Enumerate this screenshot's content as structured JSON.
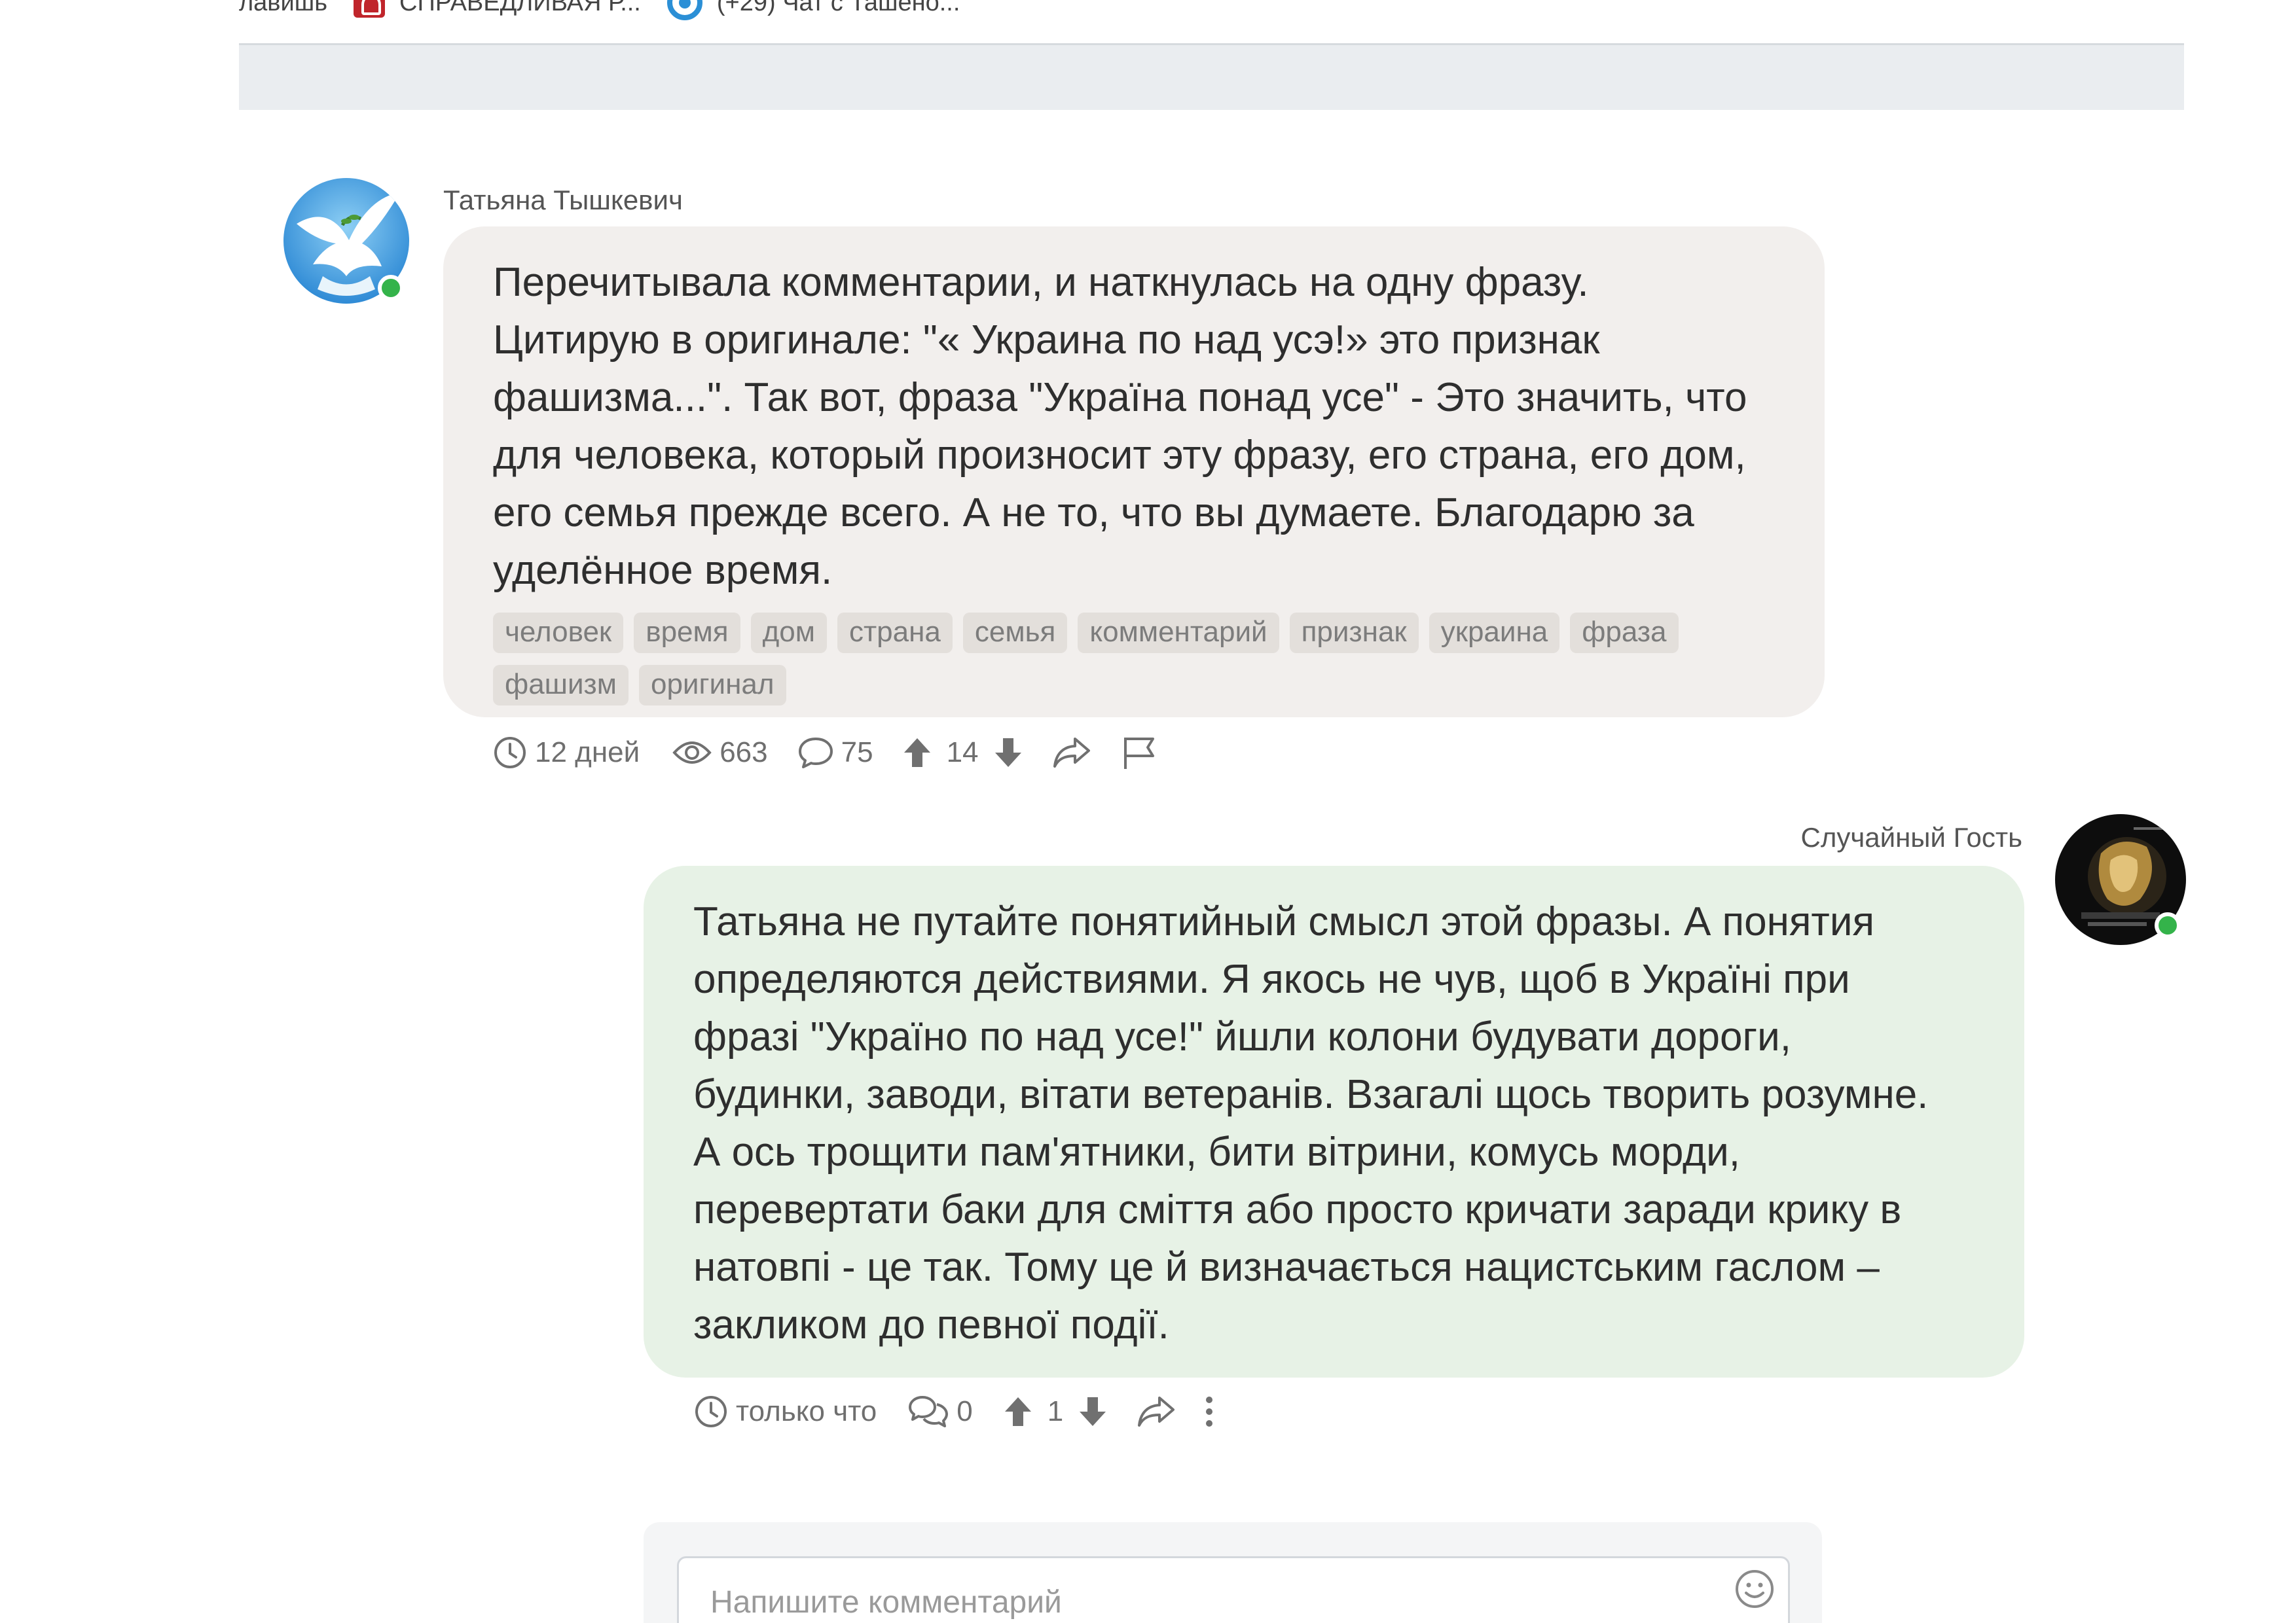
{
  "browser": {
    "bookmarks": [
      {
        "label": "лавишь",
        "icon": null
      },
      {
        "label": "СПРАВЕДЛИВАЯ Р...",
        "icon": "party-logo-icon"
      },
      {
        "label": "(+29) Чат с Ташено...",
        "icon": "chat-app-icon"
      }
    ]
  },
  "comments": [
    {
      "author": "Татьяна Тышкевич",
      "avatar": "dove-avatar",
      "online": true,
      "text": "Перечитывала комментарии, и наткнулась на одну фразу.\nЦитирую в оригинале: \"« Украина по над усэ!» это признак\nфашизма...\". Так вот, фраза \"Україна понад усе\" - Это значить, что\nдля человека, который произносит эту фразу, его страна, его дом,\nего семья прежде всего. А не то, что вы думаете. Благодарю за\nуделённое время.",
      "tags": [
        "человек",
        "время",
        "дом",
        "страна",
        "семья",
        "комментарий",
        "признак",
        "украина",
        "фраза",
        "фашизм",
        "оригинал"
      ],
      "meta": {
        "time": "12 дней",
        "views": "663",
        "comments": "75",
        "rating": "14"
      }
    },
    {
      "author": "Случайный Гость",
      "avatar": "guest-avatar",
      "online": true,
      "text": "Татьяна не путайте понятийный смысл этой фразы. А понятия\nопределяются действиями. Я якось не чув, щоб в Україні при\nфразі \"Україно по над усе!\" йшли колони будувати дороги,\nбудинки, заводи, вітати ветеранів. Взагалі щось творить розумне.\nА ось трощити пам'ятники, бити вітрини, комусь морди,\nперевертати баки для сміття або просто кричати заради крику в\nнатовпі - це так. Тому це й визначається нацистським гаслом –\nзакликом до певної події.",
      "meta": {
        "time": "только что",
        "replies": "0",
        "rating": "1"
      }
    }
  ],
  "composer": {
    "placeholder": "Напишите комментарий"
  },
  "colors": {
    "bubble_own": "#e7f2e6",
    "bubble_other": "#f2efed",
    "online": "#34b34a",
    "tag_bg": "#e3dfdb"
  }
}
